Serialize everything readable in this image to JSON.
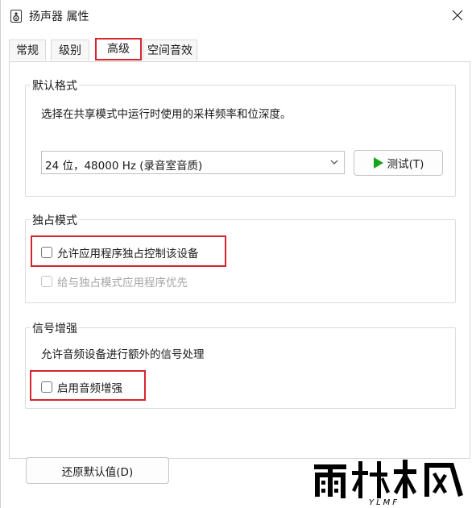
{
  "window": {
    "title": "扬声器 属性",
    "icon": "speaker-icon"
  },
  "tabs": [
    {
      "label": "常规"
    },
    {
      "label": "级别"
    },
    {
      "label": "高级",
      "selected": true
    },
    {
      "label": "空间音效"
    }
  ],
  "default_format": {
    "group_label": "默认格式",
    "description": "选择在共享模式中运行时使用的采样频率和位深度。",
    "selected_format": "24 位，48000 Hz (录音室音质)",
    "test_button_label": "测试(T)",
    "test_icon": "play-icon",
    "play_color": "#19a51b"
  },
  "exclusive_mode": {
    "group_label": "独占模式",
    "allow_exclusive_label": "允许应用程序独占控制该设备",
    "allow_exclusive_checked": false,
    "priority_label": "给与独占模式应用程序优先",
    "priority_checked": false,
    "priority_enabled": false
  },
  "signal_enhancement": {
    "group_label": "信号增强",
    "description": "允许音频设备进行额外的信号处理",
    "enable_label": "启用音频增强",
    "enable_checked": false
  },
  "restore_defaults_label": "还原默认值(D)",
  "highlight_color": "#d7252f",
  "watermark": {
    "text": "雨林木风",
    "subtext": "YLMF"
  }
}
